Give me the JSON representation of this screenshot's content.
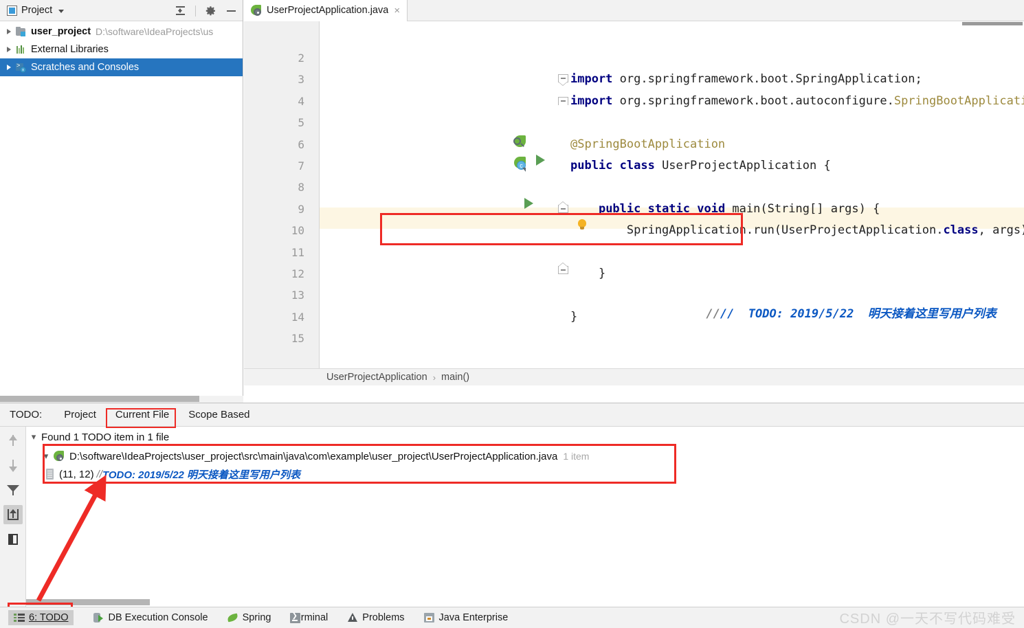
{
  "project_panel": {
    "title": "Project",
    "tools": [
      "collapse-all",
      "settings",
      "minimize"
    ],
    "tree": [
      {
        "label": "user_project",
        "path": "D:\\software\\IdeaProjects\\us",
        "icon": "module-folder-icon",
        "selected": false,
        "bold": true
      },
      {
        "label": "External Libraries",
        "path": "",
        "icon": "external-libraries-icon",
        "selected": false,
        "bold": false
      },
      {
        "label": "Scratches and Consoles",
        "path": "",
        "icon": "scratches-icon",
        "selected": true,
        "bold": false
      }
    ]
  },
  "editor": {
    "tab": {
      "filename": "UserProjectApplication.java",
      "close": "×"
    },
    "breadcrumb": {
      "class": "UserProjectApplication",
      "separator": "›",
      "method": "main()"
    },
    "lines": [
      {
        "num": "2",
        "segments": []
      },
      {
        "num": "3",
        "segments": [
          {
            "t": "import",
            "c": "kw"
          },
          {
            "t": " org.springframework.boot.SpringApplication;",
            "c": "pl"
          }
        ]
      },
      {
        "num": "4",
        "segments": [
          {
            "t": "import",
            "c": "kw"
          },
          {
            "t": " org.springframework.boot.autoconfigure.",
            "c": "pl"
          },
          {
            "t": "SpringBootApplication",
            "c": "cls"
          },
          {
            "t": ";",
            "c": "pl"
          }
        ]
      },
      {
        "num": "5",
        "segments": []
      },
      {
        "num": "6",
        "segments": [
          {
            "t": "@SpringBootApplication",
            "c": "anno"
          }
        ]
      },
      {
        "num": "7",
        "segments": [
          {
            "t": "public class",
            "c": "kw"
          },
          {
            "t": " UserProjectApplication {",
            "c": "pl"
          }
        ]
      },
      {
        "num": "8",
        "segments": []
      },
      {
        "num": "9",
        "segments": [
          {
            "t": "    ",
            "c": "pl"
          },
          {
            "t": "public static void",
            "c": "kw"
          },
          {
            "t": " main(String[] args) {",
            "c": "pl"
          }
        ]
      },
      {
        "num": "10",
        "segments": [
          {
            "t": "        SpringApplication.run(UserProjectApplication.",
            "c": "pl"
          },
          {
            "t": "class",
            "c": "kw"
          },
          {
            "t": ", args);",
            "c": "pl"
          }
        ]
      },
      {
        "num": "11",
        "segments": []
      },
      {
        "num": "12",
        "segments": [
          {
            "t": "    }",
            "c": "pl"
          }
        ]
      },
      {
        "num": "13",
        "segments": []
      },
      {
        "num": "14",
        "segments": [
          {
            "t": "}",
            "c": "pl"
          }
        ]
      },
      {
        "num": "15",
        "segments": []
      }
    ],
    "todo_comment_in_code": "//  TODO: 2019/5/22  明天接着这里写用户列表"
  },
  "todo_panel": {
    "label": "TODO:",
    "tabs": [
      {
        "label": "Project",
        "selected": false
      },
      {
        "label": "Current File",
        "selected": true
      },
      {
        "label": "Scope Based",
        "selected": false
      }
    ],
    "toolbar_icons": [
      "previous-occurrence-icon",
      "next-occurrence-icon",
      "filter-icon",
      "export-icon",
      "layout-panel-icon"
    ],
    "summary": "Found 1 TODO item in 1 file",
    "file_node": {
      "path": "D:\\software\\IdeaProjects\\user_project\\src\\main\\java\\com\\example\\user_project\\UserProjectApplication.java",
      "count": "1 item"
    },
    "item": {
      "location": "(11, 12)",
      "slashes": "//",
      "text": "TODO: 2019/5/22 明天接着这里写用户列表"
    }
  },
  "status_bar": {
    "items": [
      {
        "label": "6: TODO",
        "icon": "todo-list-icon",
        "active": true
      },
      {
        "label": "DB Execution Console",
        "icon": "database-icon",
        "active": false
      },
      {
        "label": "Spring",
        "icon": "spring-leaf-icon",
        "active": false
      },
      {
        "label": "Terminal",
        "icon": "terminal-icon",
        "active": false
      },
      {
        "label": "Problems",
        "icon": "warning-triangle-icon",
        "active": false
      },
      {
        "label": "Java Enterprise",
        "icon": "java-enterprise-icon",
        "active": false
      }
    ]
  },
  "watermark": "CSDN @一天不写代码难受",
  "colors": {
    "accent_blue": "#2675bf",
    "annotation_red": "#ee2b26",
    "keyword": "#000080",
    "annotation_gold": "#9d8a3e",
    "todo_blue": "#0a57c2",
    "highlight_row": "#fdf6e3"
  }
}
